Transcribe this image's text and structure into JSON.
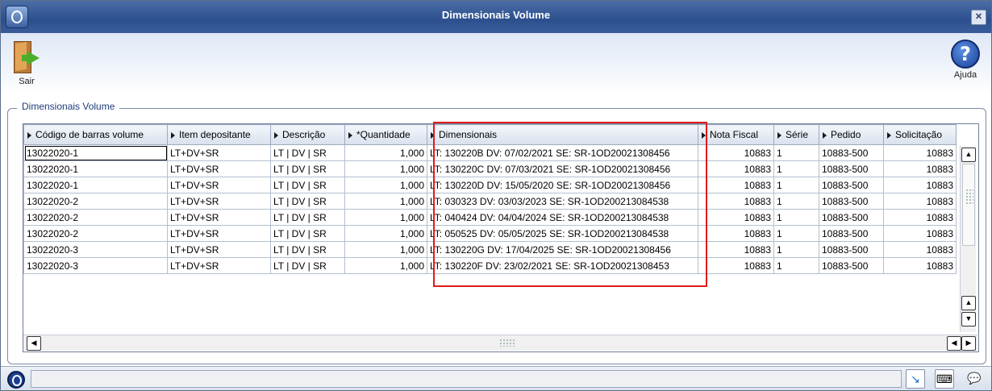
{
  "window": {
    "title": "Dimensionais Volume"
  },
  "toolbar": {
    "exit_label": "Sair",
    "help_label": "Ajuda"
  },
  "group": {
    "legend": "Dimensionais Volume"
  },
  "grid": {
    "columns": [
      "Código de barras volume",
      "Item depositante",
      "Descrição",
      "*Quantidade",
      "Dimensionais",
      "Nota Fiscal",
      "Série",
      "Pedido",
      "Solicitação"
    ],
    "rows": [
      [
        "13022020-1",
        "LT+DV+SR",
        "LT | DV | SR",
        "1,000",
        "LT: 130220B DV: 07/02/2021 SE: SR-1OD20021308456",
        "10883",
        "1",
        "10883-500",
        "10883"
      ],
      [
        "13022020-1",
        "LT+DV+SR",
        "LT | DV | SR",
        "1,000",
        "LT: 130220C DV: 07/03/2021 SE: SR-1OD20021308456",
        "10883",
        "1",
        "10883-500",
        "10883"
      ],
      [
        "13022020-1",
        "LT+DV+SR",
        "LT | DV | SR",
        "1,000",
        "LT: 130220D DV: 15/05/2020 SE: SR-1OD20021308456",
        "10883",
        "1",
        "10883-500",
        "10883"
      ],
      [
        "13022020-2",
        "LT+DV+SR",
        "LT | DV | SR",
        "1,000",
        "LT: 030323 DV: 03/03/2023 SE: SR-1OD200213084538",
        "10883",
        "1",
        "10883-500",
        "10883"
      ],
      [
        "13022020-2",
        "LT+DV+SR",
        "LT | DV | SR",
        "1,000",
        "LT: 040424 DV: 04/04/2024 SE: SR-1OD200213084538",
        "10883",
        "1",
        "10883-500",
        "10883"
      ],
      [
        "13022020-2",
        "LT+DV+SR",
        "LT | DV | SR",
        "1,000",
        "LT: 050525 DV: 05/05/2025 SE: SR-1OD200213084538",
        "10883",
        "1",
        "10883-500",
        "10883"
      ],
      [
        "13022020-3",
        "LT+DV+SR",
        "LT | DV | SR",
        "1,000",
        "LT: 130220G DV: 17/04/2025 SE: SR-1OD20021308456",
        "10883",
        "1",
        "10883-500",
        "10883"
      ],
      [
        "13022020-3",
        "LT+DV+SR",
        "LT | DV | SR",
        "1,000",
        "LT: 130220F DV: 23/02/2021 SE: SR-1OD20021308453",
        "10883",
        "1",
        "10883-500",
        "10883"
      ]
    ]
  },
  "icons": {
    "app": "totvs-logo-icon",
    "close": "close-icon",
    "exit": "exit-door-icon",
    "help": "help-question-icon",
    "status": [
      "shrink-arrow-icon",
      "keyboard-icon",
      "chat-icon"
    ]
  },
  "colors": {
    "title_bar": "#2c4f8e",
    "highlight": "#e01b1b"
  }
}
